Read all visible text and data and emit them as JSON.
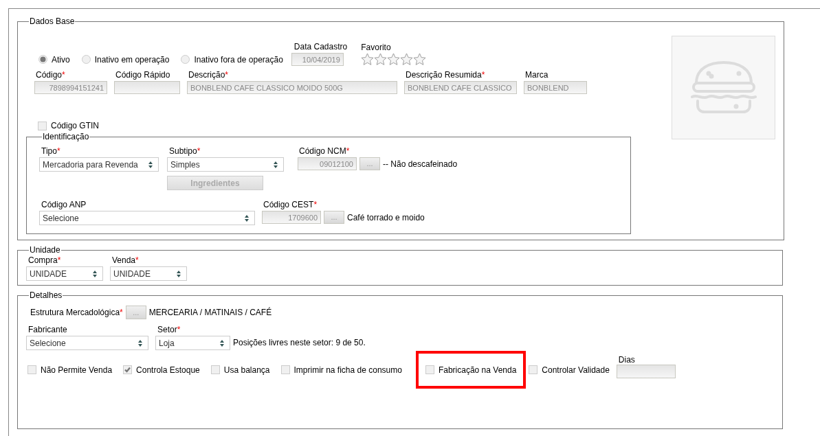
{
  "dados_base": {
    "legend": "Dados Base",
    "status_options": [
      {
        "label": "Ativo",
        "selected": true
      },
      {
        "label": "Inativo em operação",
        "selected": false
      },
      {
        "label": "Inativo fora de operação",
        "selected": false
      }
    ],
    "data_cadastro": {
      "label": "Data Cadastro",
      "value": "10/04/2019"
    },
    "favorito": {
      "label": "Favorito",
      "stars": 0
    },
    "fields": [
      {
        "label": "Código",
        "required_mark": "*",
        "value": "7898994151241"
      },
      {
        "label": "Código Rápido"
      },
      {
        "label": "Descrição",
        "required_mark": "*",
        "value": "BONBLEND CAFE CLASSICO MOIDO 500G"
      },
      {
        "label": "Descrição Resumida",
        "required_mark": "*",
        "value": "BONBLEND CAFE CLASSICO"
      },
      {
        "label": "Marca",
        "value": "BONBLEND"
      }
    ],
    "gtin": {
      "label": "Código GTIN",
      "checked": false
    }
  },
  "identificacao": {
    "legend": "Identificação",
    "tipo": {
      "label": "Tipo",
      "required_mark": "*",
      "value": "Mercadoria para Revenda"
    },
    "subtipo": {
      "label": "Subtipo",
      "required_mark": "*",
      "value": "Simples"
    },
    "ncm": {
      "label": "Código NCM",
      "required_mark": "*",
      "value": "09012100",
      "button": "...",
      "description": "-- Não descafeinado"
    },
    "ingredientes": {
      "label": "Ingredientes",
      "disabled": true
    },
    "anp": {
      "label": "Código ANP",
      "value": "Selecione"
    },
    "cest": {
      "label": "Código CEST",
      "required_mark": "*",
      "value": "1709600",
      "button": "...",
      "description": "Café torrado e moido"
    }
  },
  "unidade": {
    "legend": "Unidade",
    "compra": {
      "label": "Compra",
      "required_mark": "*",
      "value": "UNIDADE"
    },
    "venda": {
      "label": "Venda",
      "required_mark": "*",
      "value": "UNIDADE"
    }
  },
  "detalhes": {
    "legend": "Detalhes",
    "estrutura": {
      "label": "Estrutura Mercadológica",
      "required_mark": "*",
      "button": "...",
      "value": "MERCEARIA / MATINAIS / CAFÉ"
    },
    "fabricante": {
      "label": "Fabricante",
      "value": "Selecione"
    },
    "setor": {
      "label": "Setor",
      "required_mark": "*",
      "value": "Loja",
      "note": "Posições livres neste setor: 9 de 50."
    },
    "options": [
      {
        "label": "Não Permite Venda",
        "checked": false,
        "highlighted": false
      },
      {
        "label": "Controla Estoque",
        "checked": true,
        "highlighted": false
      },
      {
        "label": "Usa balança",
        "checked": false,
        "highlighted": false
      },
      {
        "label": "Imprimir na ficha de consumo",
        "checked": false,
        "highlighted": false
      },
      {
        "label": "Fabricação na Venda",
        "checked": false,
        "highlighted": true
      },
      {
        "label": "Controlar Validade",
        "checked": false,
        "highlighted": false
      }
    ],
    "dias": {
      "label": "Dias"
    }
  }
}
